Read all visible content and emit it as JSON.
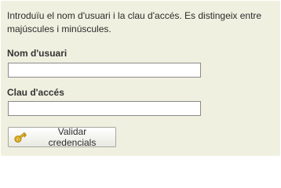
{
  "login": {
    "intro": "Introduïu el nom d'usuari i la clau d'accés. Es distingeix entre majúscules i minúscules.",
    "username_label": "Nom d'usuari",
    "username_value": "",
    "password_label": "Clau d'accés",
    "password_value": "",
    "submit_label": "Validar credencials",
    "submit_icon": "key-icon"
  },
  "colors": {
    "panel_background": "#f0f0e1",
    "key_gold": "#e8b928"
  }
}
